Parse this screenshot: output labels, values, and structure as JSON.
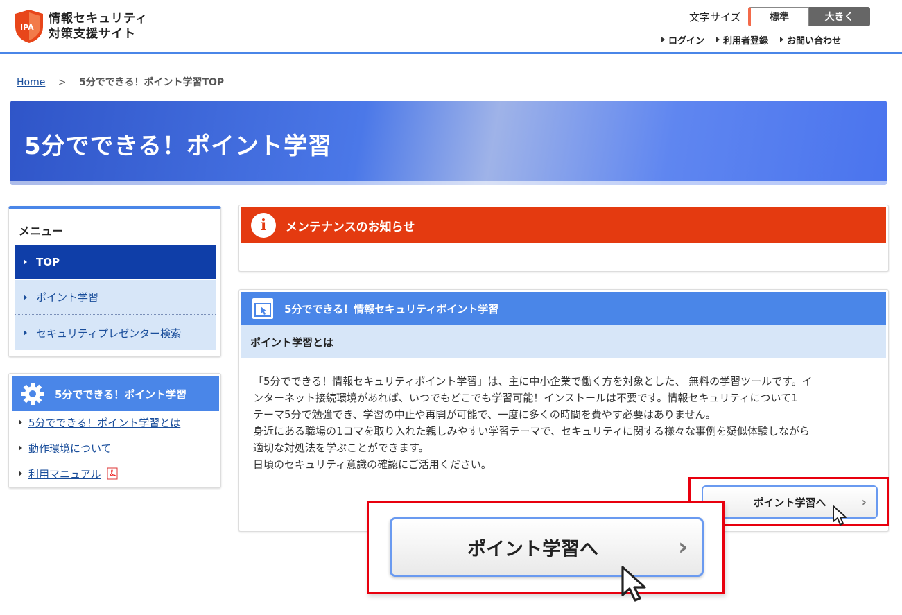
{
  "header": {
    "logo_mark": "IPA",
    "logo_line1": "情報セキュリティ",
    "logo_line2": "対策支援サイト",
    "font_size_label": "文字サイズ",
    "font_size_standard": "標準",
    "font_size_large": "大きく",
    "links": [
      "ログイン",
      "利用者登録",
      "お問い合わせ"
    ]
  },
  "breadcrumb": {
    "home": "Home",
    "separator": ">",
    "current": "5分でできる！ポイント学習TOP"
  },
  "banner": {
    "title": "5分でできる！ポイント学習"
  },
  "menu": {
    "title": "メニュー",
    "items": [
      "TOP",
      "ポイント学習",
      "セキュリティプレゼンター検索"
    ]
  },
  "side_section": {
    "title": "5分でできる！ポイント学習",
    "links": [
      "5分でできる！ポイント学習とは",
      "動作環境について",
      "利用マニュアル"
    ]
  },
  "maintenance": {
    "title": "メンテナンスのお知らせ"
  },
  "learning": {
    "title": "5分でできる！情報セキュリティポイント学習",
    "subtitle": "ポイント学習とは",
    "lines": [
      "「5分でできる！情報セキュリティポイント学習」は、主に中小企業で働く方を対象とした、 無料の学習ツールです。イ",
      "ンターネット接続環境があれば、いつでもどこでも学習可能！インストールは不要です。情報セキュリティについて1",
      "テーマ5分で勉強でき、学習の中止や再開が可能で、一度に多くの時間を費やす必要はありません。",
      "身近にある職場の1コマを取り入れた親しみやすい学習テーマで、セキュリティに関する様々な事例を疑似体験しながら",
      "適切な対処法を学ぶことができます。",
      "日頃のセキュリティ意識の確認にご活用ください。"
    ],
    "button_label": "ポイント学習へ",
    "button_zoom_label": "ポイント学習へ"
  }
}
